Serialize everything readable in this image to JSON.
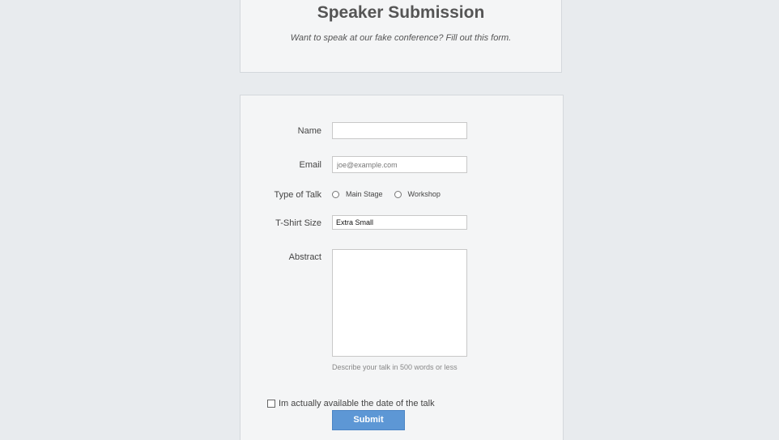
{
  "header": {
    "title": "Speaker Submission",
    "subtitle": "Want to speak at our fake conference? Fill out this form."
  },
  "form": {
    "name": {
      "label": "Name",
      "value": ""
    },
    "email": {
      "label": "Email",
      "placeholder": "joe@example.com"
    },
    "talk_type": {
      "label": "Type of Talk",
      "options": [
        "Main Stage",
        "Workshop"
      ]
    },
    "tshirt": {
      "label": "T-Shirt Size",
      "value": "Extra Small"
    },
    "abstract": {
      "label": "Abstract",
      "help": "Describe your talk in 500 words or less"
    },
    "availability": {
      "label": "Im actually available the date of the talk",
      "checked": false
    },
    "submit_label": "Submit"
  }
}
